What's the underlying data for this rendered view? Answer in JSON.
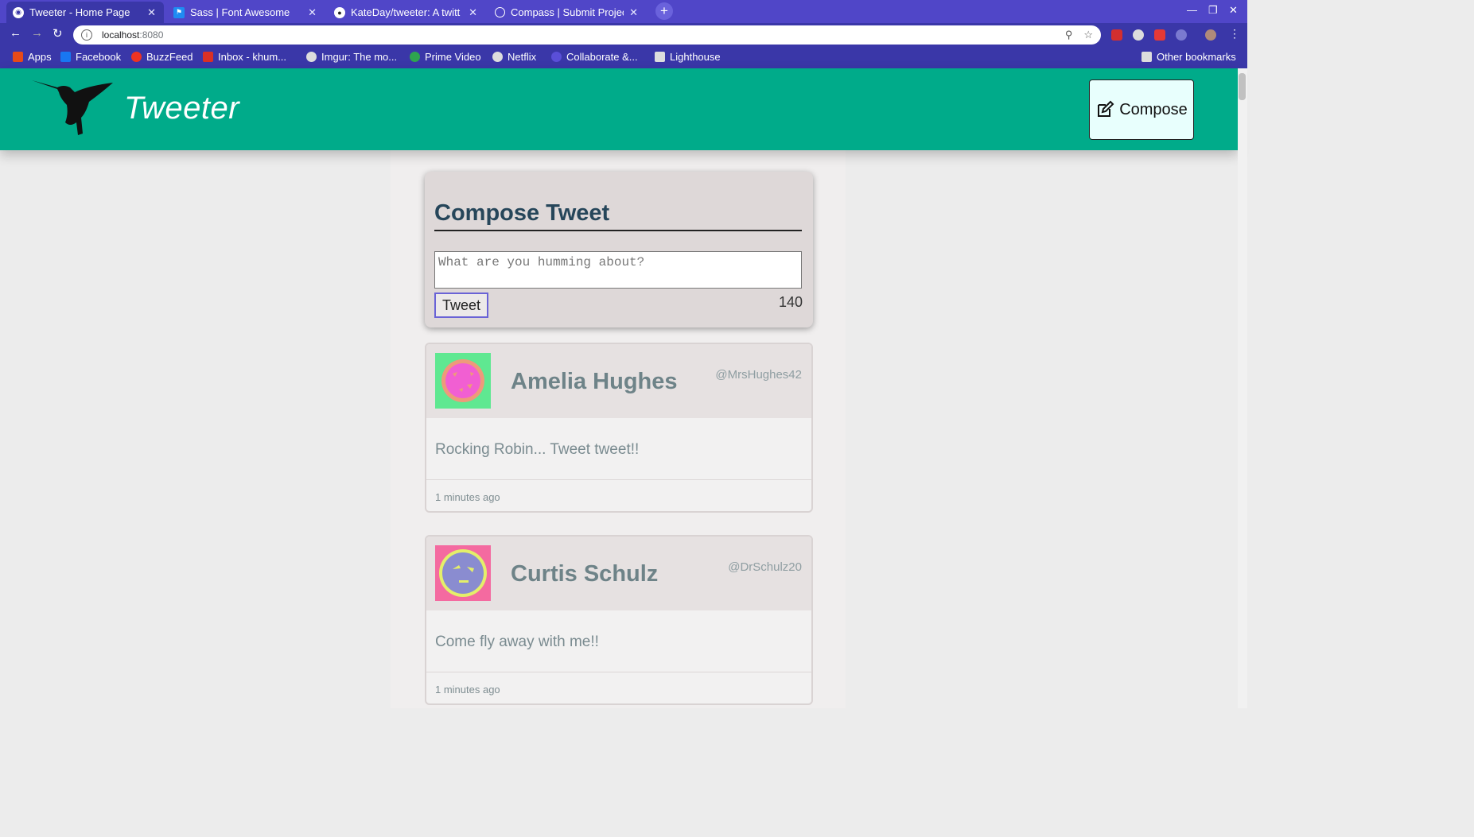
{
  "browser": {
    "tabs": [
      {
        "title": "Tweeter - Home Page",
        "active": true
      },
      {
        "title": "Sass | Font Awesome",
        "active": false
      },
      {
        "title": "KateDay/tweeter: A twitt",
        "active": false
      },
      {
        "title": "Compass | Submit Project",
        "active": false
      }
    ],
    "tab_close_glyph": "✕",
    "new_tab_glyph": "+",
    "url_host": "localhost",
    "url_port": ":8080",
    "bookmarks": [
      {
        "label": "Apps",
        "icon": "apps-grid-icon",
        "color": "#e64a19"
      },
      {
        "label": "Facebook",
        "icon": "facebook-icon",
        "color": "#1877f2"
      },
      {
        "label": "BuzzFeed",
        "icon": "buzzfeed-icon",
        "color": "#ee3322"
      },
      {
        "label": "Inbox - khum...",
        "icon": "gmail-icon",
        "color": "#d93025"
      },
      {
        "label": "Imgur: The mo...",
        "icon": "globe-icon",
        "color": "#dddddd"
      },
      {
        "label": "Prime Video",
        "icon": "prime-video-icon",
        "color": "#2ea44f"
      },
      {
        "label": "Netflix",
        "icon": "globe-icon",
        "color": "#dddddd"
      },
      {
        "label": "Collaborate &...",
        "icon": "collaborate-icon",
        "color": "#5a4fd8"
      },
      {
        "label": "Lighthouse",
        "icon": "folder-icon",
        "color": "#dddddd"
      }
    ],
    "other_bookmarks": "Other bookmarks"
  },
  "header": {
    "brand": "Tweeter",
    "compose_label": "Compose",
    "accent_color": "#00ab8a"
  },
  "compose": {
    "title": "Compose Tweet",
    "placeholder": "What are you humming about?",
    "button_label": "Tweet",
    "counter": "140"
  },
  "tweets": [
    {
      "name": "Amelia Hughes",
      "handle": "@MrsHughes42",
      "content": "Rocking Robin... Tweet tweet!!",
      "time": "1 minutes ago",
      "avatar": "pizza-avatar-icon"
    },
    {
      "name": "Curtis Schulz",
      "handle": "@DrSchulz20",
      "content": "Come fly away with me!!",
      "time": "1 minutes ago",
      "avatar": "face-avatar-icon"
    }
  ]
}
